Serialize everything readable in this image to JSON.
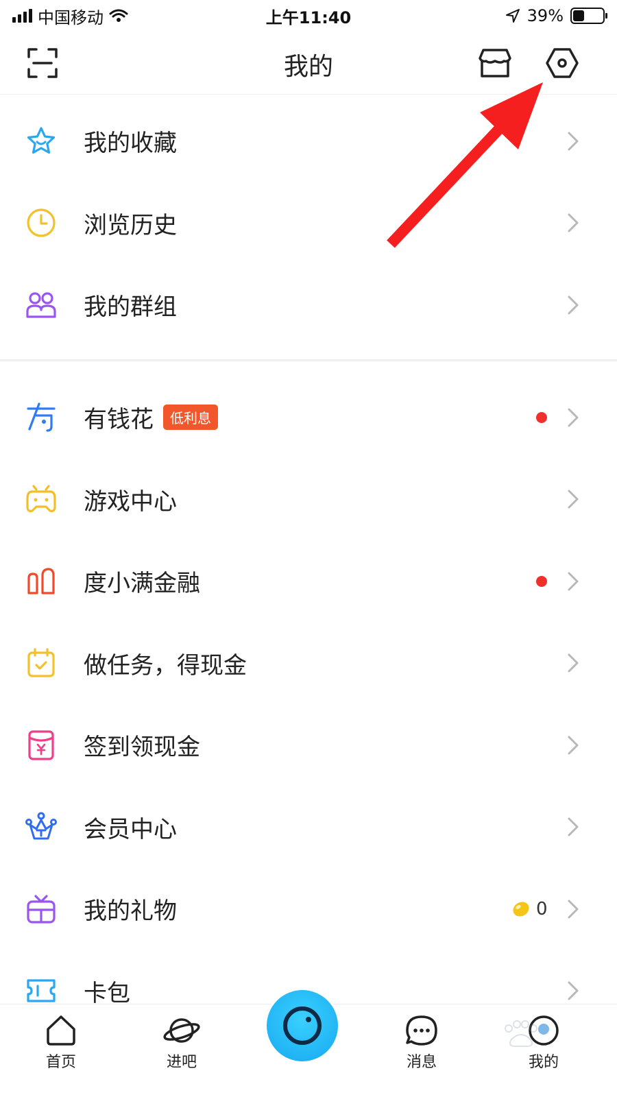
{
  "status_bar": {
    "carrier": "中国移动",
    "time": "上午11:40",
    "battery_percent": "39%",
    "battery_level": 0.39
  },
  "header": {
    "title": "我的",
    "icons": [
      "scan-icon",
      "store-icon",
      "settings-icon"
    ]
  },
  "section_1": [
    {
      "label": "我的收藏",
      "icon": "star-icon",
      "color": "#2aa7f0"
    },
    {
      "label": "浏览历史",
      "icon": "clock-icon",
      "color": "#f2c12e"
    },
    {
      "label": "我的群组",
      "icon": "group-icon",
      "color": "#9a55f0"
    }
  ],
  "section_2": [
    {
      "label": "有钱花",
      "icon": "youqianhua-icon",
      "color": "#2f7cf0",
      "badge": "低利息",
      "dot": true
    },
    {
      "label": "游戏中心",
      "icon": "gamepad-icon",
      "color": "#f2bf2a"
    },
    {
      "label": "度小满金融",
      "icon": "duxiaoman-icon",
      "color": "#f04a2b",
      "dot": true
    },
    {
      "label": "做任务，得现金",
      "icon": "calendar-check-icon",
      "color": "#f2c12e"
    },
    {
      "label": "签到领现金",
      "icon": "red-envelope-icon",
      "color": "#ee3f8a"
    },
    {
      "label": "会员中心",
      "icon": "crown-icon",
      "color": "#2f6cf0"
    },
    {
      "label": "我的礼物",
      "icon": "gift-icon",
      "color": "#9a55f0",
      "count": "0"
    },
    {
      "label": "卡包",
      "icon": "ticket-icon",
      "color": "#2aa7f0"
    }
  ],
  "tabbar": {
    "tabs": [
      {
        "label": "首页",
        "icon": "home-icon"
      },
      {
        "label": "进吧",
        "icon": "planet-icon"
      },
      {
        "label": "消息",
        "icon": "message-icon"
      },
      {
        "label": "我的",
        "icon": "profile-icon"
      }
    ],
    "center": "camera-icon"
  },
  "colors": {
    "accent": "#17a8f0",
    "badge": "#f2572b",
    "dot": "#f0312b",
    "annotation_arrow": "#f51f1f"
  }
}
